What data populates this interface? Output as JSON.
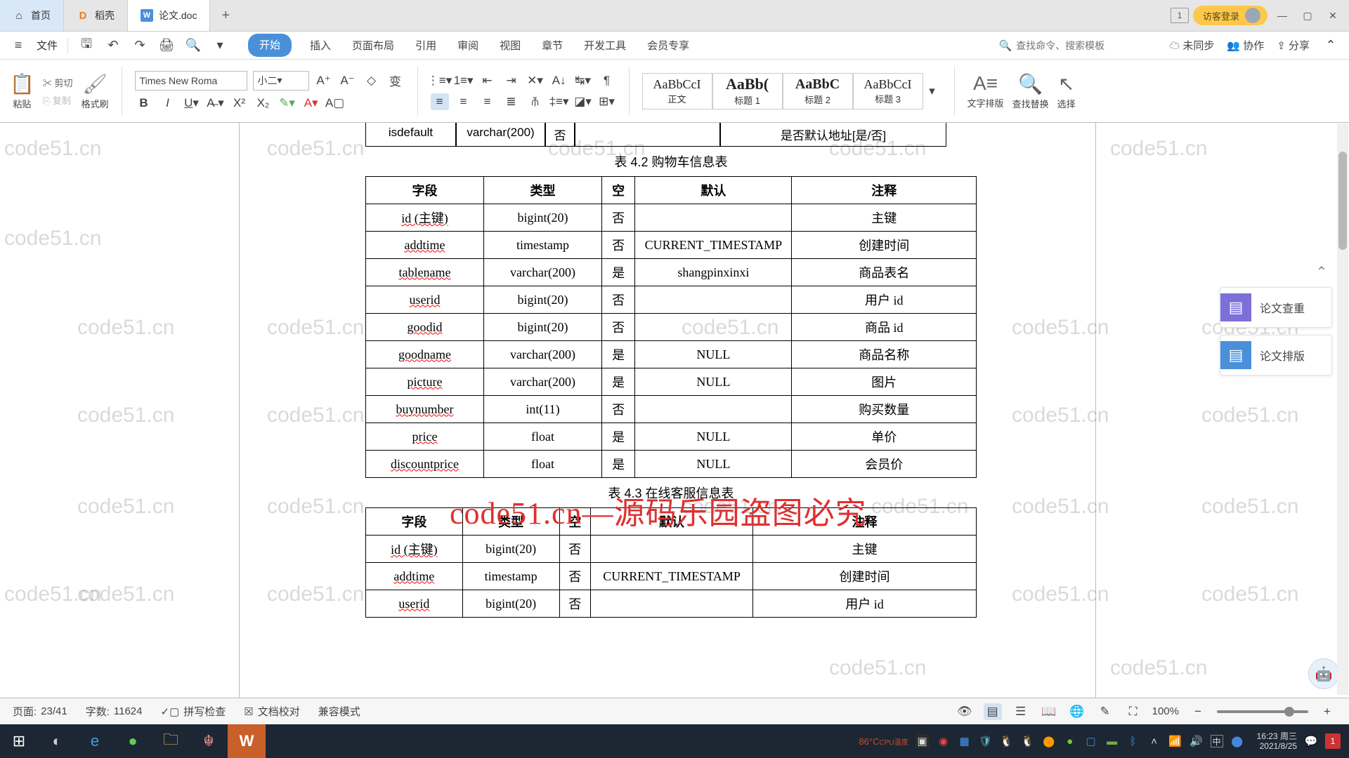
{
  "tabs": {
    "home": "首页",
    "doc1": "稻壳",
    "doc2": "论文.doc",
    "plus": "+"
  },
  "title_right": {
    "num": "1",
    "login": "访客登录"
  },
  "quick": {
    "file": "文件"
  },
  "menus": [
    "开始",
    "插入",
    "页面布局",
    "引用",
    "审阅",
    "视图",
    "章节",
    "开发工具",
    "会员专享"
  ],
  "search_ph": "查找命令、搜索模板",
  "qb_right": {
    "unsync": "未同步",
    "coop": "协作",
    "share": "分享"
  },
  "ribbon": {
    "paste": "粘贴",
    "cut": "剪切",
    "copy": "复制",
    "format": "格式刷",
    "font_name": "Times New Roma",
    "font_size": "小二",
    "styles": [
      {
        "preview": "AaBbCcI",
        "label": "正文"
      },
      {
        "preview": "AaBb(",
        "label": "标题 1"
      },
      {
        "preview": "AaBbC",
        "label": "标题 2"
      },
      {
        "preview": "AaBbCcI",
        "label": "标题 3"
      }
    ],
    "text_layout": "文字排版",
    "find": "查找替换",
    "select": "选择"
  },
  "side": {
    "check": "论文查重",
    "layout": "论文排版"
  },
  "doc": {
    "partial": {
      "c1": "isdefault",
      "c2": "varchar(200)",
      "c3": "否",
      "c5": "是否默认地址[是/否]"
    },
    "cap1": "表 4.2  购物车信息表",
    "t1_head": [
      "字段",
      "类型",
      "空",
      "默认",
      "注释"
    ],
    "t1_rows": [
      [
        "id (主键)",
        "bigint(20)",
        "否",
        "",
        "主键"
      ],
      [
        "addtime",
        "timestamp",
        "否",
        "CURRENT_TIMESTAMP",
        "创建时间"
      ],
      [
        "tablename",
        "varchar(200)",
        "是",
        "shangpinxinxi",
        "商品表名"
      ],
      [
        "userid",
        "bigint(20)",
        "否",
        "",
        "用户 id"
      ],
      [
        "goodid",
        "bigint(20)",
        "否",
        "",
        "商品 id"
      ],
      [
        "goodname",
        "varchar(200)",
        "是",
        "NULL",
        "商品名称"
      ],
      [
        "picture",
        "varchar(200)",
        "是",
        "NULL",
        "图片"
      ],
      [
        "buynumber",
        "int(11)",
        "否",
        "",
        "购买数量"
      ],
      [
        "price",
        "float",
        "是",
        "NULL",
        "单价"
      ],
      [
        "discountprice",
        "float",
        "是",
        "NULL",
        "会员价"
      ]
    ],
    "cap2": "表 4.3  在线客服信息表",
    "t2_head": [
      "字段",
      "类型",
      "空",
      "默认",
      "注释"
    ],
    "t2_rows": [
      [
        "id (主键)",
        "bigint(20)",
        "否",
        "",
        "主键"
      ],
      [
        "addtime",
        "timestamp",
        "否",
        "CURRENT_TIMESTAMP",
        "创建时间"
      ],
      [
        "userid",
        "bigint(20)",
        "否",
        "",
        "用户 id"
      ]
    ]
  },
  "overlay": "code51.cn—源码乐园盗图必究",
  "watermark": "code51.cn",
  "status": {
    "page_lbl": "页面:",
    "page_val": "23/41",
    "words_lbl": "字数:",
    "words_val": "11624",
    "spell": "拼写检查",
    "proof": "文档校对",
    "compat": "兼容模式",
    "zoom": "100%"
  },
  "tray": {
    "cpu": "86°C",
    "cpu_lbl": "CPU温度",
    "ime": "中",
    "time": "16:23",
    "day": "周三",
    "date": "2021/8/25",
    "badge": "1"
  }
}
